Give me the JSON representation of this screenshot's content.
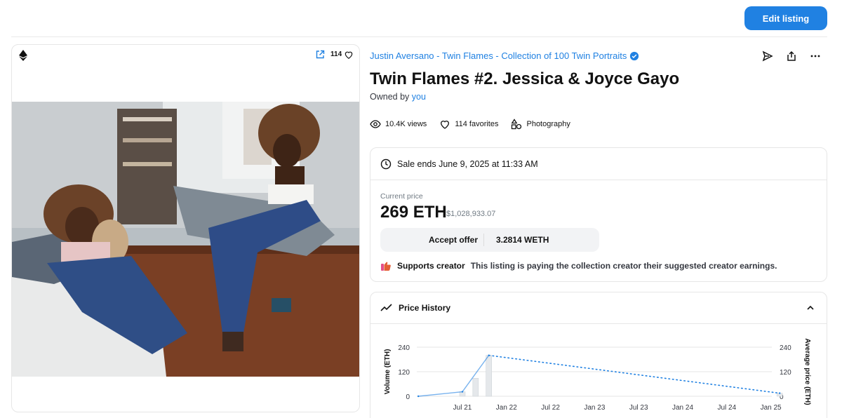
{
  "header": {
    "edit_label": "Edit listing"
  },
  "media": {
    "favorite_count": "114"
  },
  "item": {
    "collection": "Justin Aversano - Twin Flames - Collection of 100 Twin Portraits",
    "title": "Twin Flames #2. Jessica & Joyce Gayo",
    "owned_prefix": "Owned by",
    "owner": "you"
  },
  "stats": {
    "views": "10.4K views",
    "favorites": "114 favorites",
    "category": "Photography"
  },
  "sale": {
    "ends": "Sale ends June 9, 2025 at 11:33 AM",
    "price_label": "Current price",
    "price": "269 ETH",
    "price_usd": "$1,028,933.07",
    "accept_label": "Accept offer",
    "offer_amount": "3.2814 WETH",
    "creator_label": "Supports creator",
    "creator_text": "This listing is paying the collection creator their suggested creator earnings."
  },
  "history": {
    "title": "Price History"
  },
  "colors": {
    "accent": "#2081e2",
    "text": "#121212",
    "muted": "#707a83"
  },
  "chart_data": {
    "type": "line",
    "x": [
      "Jul 21",
      "Jan 22",
      "Jul 22",
      "Jan 23",
      "Jul 23",
      "Jan 24",
      "Jul 24",
      "Jan 25"
    ],
    "ylabel_left": "Volume (ETH)",
    "ylabel_right": "Average price (ETH)",
    "yticks": [
      0,
      120,
      240
    ],
    "ylim": [
      0,
      240
    ],
    "series": [
      {
        "points": [
          [
            0.0,
            0
          ],
          [
            1.0,
            22
          ],
          [
            1.6,
            200
          ],
          [
            8.2,
            15
          ]
        ]
      }
    ],
    "bars": [
      [
        1.0,
        22
      ],
      [
        1.3,
        88
      ],
      [
        1.6,
        200
      ],
      [
        8.2,
        15
      ]
    ],
    "grid": true
  }
}
